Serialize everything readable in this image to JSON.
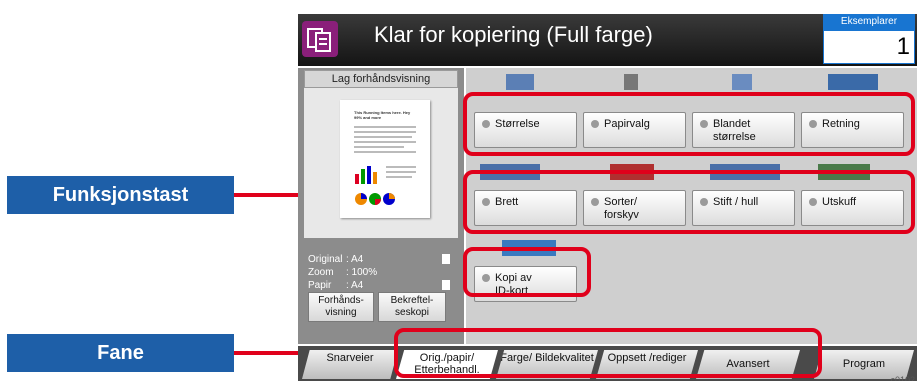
{
  "callouts": {
    "function_key": "Funksjonstast",
    "tab": "Fane"
  },
  "header": {
    "title": "Klar for kopiering (Full farge)",
    "copies_label": "Eksemplarer",
    "copies_value": "1"
  },
  "preview": {
    "tab_label": "Lag forhåndsvisning",
    "doc_title": "This Running Items here. Hey 99% and more"
  },
  "info": [
    {
      "key": "Original",
      "value": ": A4"
    },
    {
      "key": "Zoom",
      "value": ": 100%"
    },
    {
      "key": "Papir",
      "value": ": A4"
    }
  ],
  "left_buttons": {
    "preview": "Forhånds-\nvisning",
    "confirm": "Bekreftel-\nseskopi"
  },
  "function_keys": {
    "row1": [
      "Størrelse",
      "Papirvalg",
      "Blandet størrelse",
      "Retning"
    ],
    "row2": [
      "Brett",
      "Sorter/ forskyv",
      "Stift / hull",
      "Utskuff"
    ],
    "row3": [
      "Kopi av ID-kort"
    ]
  },
  "tabs": [
    "Snarveier",
    "Orig./papir/ Etterbehandl.",
    "Farge/ Bildekvalitet",
    "Oppsett /rediger",
    "Avansert",
    "Program"
  ],
  "footnote": "c0102",
  "colors": {
    "callout_bg": "#1e5fa8",
    "highlight": "#e0001b",
    "header_bg": "#141414",
    "copies_accent": "#1875d1"
  },
  "icons": [
    "copy-mode-icon",
    "size-icon",
    "paper-icon",
    "mixed-size-icon",
    "orientation-icon",
    "fold-icon",
    "collate-icon",
    "staple-icon",
    "output-tray-icon",
    "id-card-icon"
  ]
}
